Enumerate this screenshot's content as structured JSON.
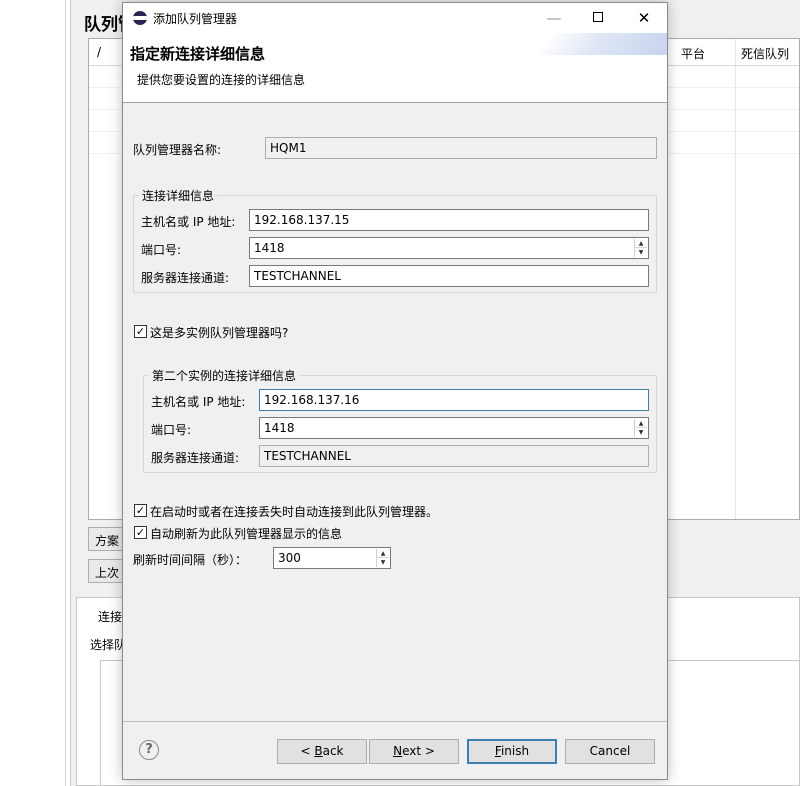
{
  "background": {
    "title": "队列管",
    "columns": [
      "/",
      "平台",
      "死信队列"
    ],
    "scheme_button": "方案",
    "last_button": "上次",
    "bottom_tab": "连接",
    "bottom_label": "选择队"
  },
  "dialog": {
    "title": "添加队列管理器",
    "window_controls": {
      "minimize": "—",
      "close": "✕"
    },
    "header": {
      "title": "指定新连接详细信息",
      "description": "提供您要设置的连接的详细信息"
    },
    "qmgr_name": {
      "label": "队列管理器名称:",
      "value": "HQM1"
    },
    "connection_group": {
      "legend": "连接详细信息",
      "host": {
        "label": "主机名或 IP 地址:",
        "value": "192.168.137.15"
      },
      "port": {
        "label": "端口号:",
        "value": "1418"
      },
      "channel": {
        "label": "服务器连接通道:",
        "value": "TESTCHANNEL"
      }
    },
    "multi_instance": {
      "label": "这是多实例队列管理器吗?",
      "checked": true
    },
    "second_group": {
      "legend": "第二个实例的连接详细信息",
      "host": {
        "label": "主机名或 IP 地址:",
        "value": "192.168.137.16"
      },
      "port": {
        "label": "端口号:",
        "value": "1418"
      },
      "channel": {
        "label": "服务器连接通道:",
        "value": "TESTCHANNEL"
      }
    },
    "auto_connect": {
      "label": "在启动时或者在连接丢失时自动连接到此队列管理器。",
      "checked": true
    },
    "auto_refresh": {
      "label": "自动刷新为此队列管理器显示的信息",
      "checked": true
    },
    "refresh_interval": {
      "label": "刷新时间间隔（秒）：",
      "value": "300"
    },
    "buttons": {
      "back": {
        "prefix": "< ",
        "mnemonic": "B",
        "rest": "ack"
      },
      "next": {
        "mnemonic": "N",
        "rest": "ext",
        "suffix": " >"
      },
      "finish": {
        "mnemonic": "F",
        "rest": "inish"
      },
      "cancel": "Cancel"
    },
    "help_glyph": "?"
  }
}
